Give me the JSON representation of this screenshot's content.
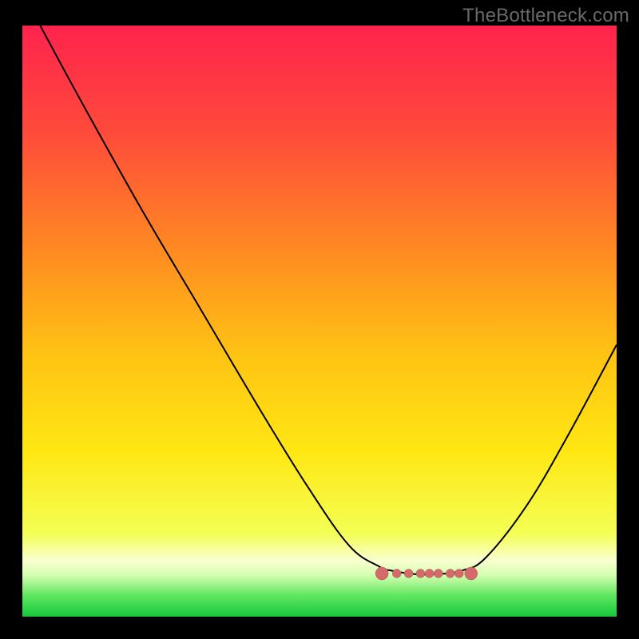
{
  "watermark": "TheBottleneck.com",
  "chart_data": {
    "type": "line",
    "title": "",
    "xlabel": "",
    "ylabel": "",
    "xlim": [
      0,
      100
    ],
    "ylim": [
      0,
      100
    ],
    "background": {
      "description": "vertical gradient red→orange→yellow→green with thin near-white band near bottom",
      "stops": [
        {
          "offset": 0.0,
          "color": "#ff234d"
        },
        {
          "offset": 0.18,
          "color": "#ff4a3b"
        },
        {
          "offset": 0.38,
          "color": "#ff8a22"
        },
        {
          "offset": 0.56,
          "color": "#ffc413"
        },
        {
          "offset": 0.72,
          "color": "#ffe713"
        },
        {
          "offset": 0.86,
          "color": "#f4ff55"
        },
        {
          "offset": 0.905,
          "color": "#faffd0"
        },
        {
          "offset": 0.93,
          "color": "#d3ffb0"
        },
        {
          "offset": 0.965,
          "color": "#5fe65f"
        },
        {
          "offset": 1.0,
          "color": "#17c63e"
        }
      ]
    },
    "series": [
      {
        "name": "bottleneck-curve",
        "description": "Black V-shaped curve: steep descent from top-left to a flat valley around x≈62–74 at y≈7, then rises to mid-right edge",
        "points": [
          {
            "x": 3,
            "y": 100
          },
          {
            "x": 10,
            "y": 87
          },
          {
            "x": 20,
            "y": 69
          },
          {
            "x": 30,
            "y": 52
          },
          {
            "x": 40,
            "y": 35
          },
          {
            "x": 48,
            "y": 22
          },
          {
            "x": 55,
            "y": 12
          },
          {
            "x": 60,
            "y": 8.5
          },
          {
            "x": 62,
            "y": 7.8
          },
          {
            "x": 66,
            "y": 7.2
          },
          {
            "x": 70,
            "y": 7.2
          },
          {
            "x": 74,
            "y": 7.8
          },
          {
            "x": 78,
            "y": 10
          },
          {
            "x": 85,
            "y": 19
          },
          {
            "x": 92,
            "y": 31
          },
          {
            "x": 100,
            "y": 46
          }
        ]
      }
    ],
    "valley_markers": {
      "description": "Muted-red dashed-dot segment marking the flat minimum of the curve",
      "y": 7.3,
      "x_start": 60.5,
      "x_end": 75.5,
      "color": "#d46a6a",
      "dots_x": [
        60.5,
        63,
        65,
        67,
        68.5,
        70,
        72,
        73.5,
        75.5
      ]
    }
  }
}
